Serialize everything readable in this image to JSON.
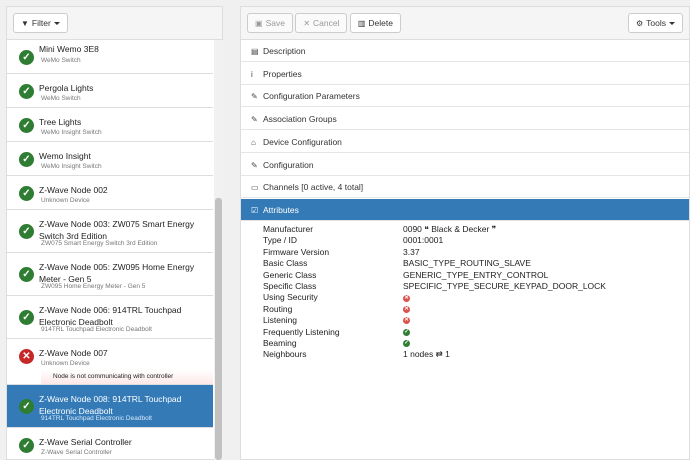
{
  "left": {
    "filter_label": "Filter",
    "devices": [
      {
        "name": "Mini Wemo 3E8",
        "sub": "WeMo Switch",
        "status": "ok"
      },
      {
        "name": "Pergola Lights",
        "sub": "WeMo Switch",
        "status": "ok"
      },
      {
        "name": "Tree Lights",
        "sub": "WeMo Insight Switch",
        "status": "ok"
      },
      {
        "name": "Wemo Insight",
        "sub": "WeMo Insight Switch",
        "status": "ok"
      },
      {
        "name": "Z-Wave Node 002",
        "sub": "Unknown Device",
        "status": "ok"
      },
      {
        "name": "Z-Wave Node 003: ZW075 Smart Energy Switch 3rd Edition",
        "sub": "ZW075 Smart Energy Switch 3rd Edition",
        "status": "ok"
      },
      {
        "name": "Z-Wave Node 005: ZW095 Home Energy Meter - Gen 5",
        "sub": "ZW095 Home Energy Meter - Gen 5",
        "status": "ok"
      },
      {
        "name": "Z-Wave Node 006: 914TRL Touchpad Electronic Deadbolt",
        "sub": "914TRL Touchpad Electronic Deadbolt",
        "status": "ok"
      },
      {
        "name": "Z-Wave Node 007",
        "sub": "Unknown Device",
        "status": "bad",
        "warning": "Node is not communicating with controller"
      },
      {
        "name": "Z-Wave Node 008: 914TRL Touchpad Electronic Deadbolt",
        "sub": "914TRL Touchpad Electronic Deadbolt",
        "status": "ok",
        "selected": true
      },
      {
        "name": "Z-Wave Serial Controller",
        "sub": "Z-Wave Serial Controller",
        "status": "ok"
      }
    ]
  },
  "right": {
    "toolbar": {
      "save_label": "Save",
      "cancel_label": "Cancel",
      "delete_label": "Delete",
      "tools_label": "Tools"
    },
    "sections": [
      {
        "label": "Description",
        "icon": "book-icon"
      },
      {
        "label": "Properties",
        "icon": "info-icon"
      },
      {
        "label": "Configuration Parameters",
        "icon": "wrench-icon"
      },
      {
        "label": "Association Groups",
        "icon": "wrench-icon"
      },
      {
        "label": "Device Configuration",
        "icon": "home-icon"
      },
      {
        "label": "Configuration",
        "icon": "wrench-icon"
      },
      {
        "label": "Channels [0 active, 4 total]",
        "icon": "folder-icon"
      },
      {
        "label": "Attributes",
        "icon": "edit-icon",
        "active": true
      }
    ],
    "attributes": [
      {
        "key": "Manufacturer",
        "value": "0090 ❝ Black & Decker ❞"
      },
      {
        "key": "Type / ID",
        "value": "0001:0001"
      },
      {
        "key": "Firmware Version",
        "value": "3.37"
      },
      {
        "key": "Basic Class",
        "value": "BASIC_TYPE_ROUTING_SLAVE"
      },
      {
        "key": "Generic Class",
        "value": "GENERIC_TYPE_ENTRY_CONTROL"
      },
      {
        "key": "Specific Class",
        "value": "SPECIFIC_TYPE_SECURE_KEYPAD_DOOR_LOCK"
      },
      {
        "key": "Using Security",
        "flag": false
      },
      {
        "key": "Routing",
        "flag": false
      },
      {
        "key": "Listening",
        "flag": false
      },
      {
        "key": "Frequently Listening",
        "flag": true
      },
      {
        "key": "Beaming",
        "flag": true
      },
      {
        "key": "Neighbours",
        "value": "1 nodes ⇄ 1"
      }
    ]
  }
}
